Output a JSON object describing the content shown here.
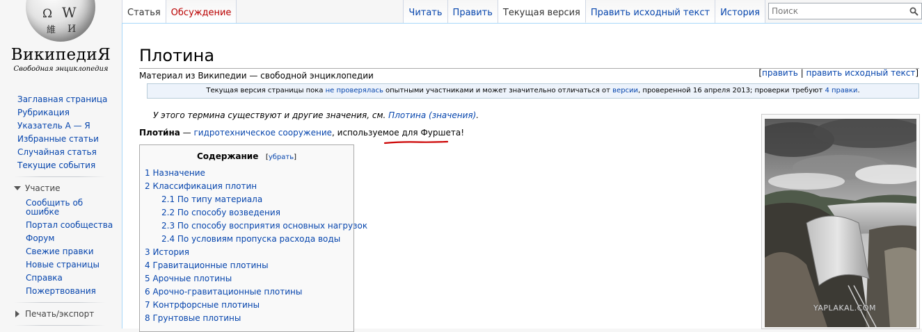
{
  "logo": {
    "name": "ВикипедиЯ",
    "tagline": "Свободная энциклопедия",
    "glyphs": [
      "Ω",
      "W",
      "維",
      "И"
    ]
  },
  "sidebar": {
    "main_links": [
      {
        "label": "Заглавная страница"
      },
      {
        "label": "Рубрикация"
      },
      {
        "label": "Указатель А — Я"
      },
      {
        "label": "Избранные статьи"
      },
      {
        "label": "Случайная статья"
      },
      {
        "label": "Текущие события"
      }
    ],
    "participation": {
      "heading": "Участие",
      "links": [
        {
          "label": "Сообщить об ошибке"
        },
        {
          "label": "Портал сообщества"
        },
        {
          "label": "Форум"
        },
        {
          "label": "Свежие правки"
        },
        {
          "label": "Новые страницы"
        },
        {
          "label": "Справка"
        },
        {
          "label": "Пожертвования"
        }
      ]
    },
    "print_heading": "Печать/экспорт"
  },
  "tabs": {
    "left": [
      {
        "label": "Статья"
      },
      {
        "label": "Обсуждение"
      }
    ],
    "right": [
      {
        "label": "Читать"
      },
      {
        "label": "Править"
      },
      {
        "label": "Текущая версия"
      },
      {
        "label": "Править исходный текст"
      },
      {
        "label": "История"
      }
    ]
  },
  "search": {
    "placeholder": "Поиск"
  },
  "article": {
    "title": "Плотина",
    "site_sub": "Материал из Википедии — свободной энциклопедии",
    "edit_links": {
      "open": "[",
      "edit": "править",
      "sep": " | ",
      "edit_source": "править исходный текст",
      "close": "]"
    },
    "flagged": {
      "t1": "Текущая версия страницы пока ",
      "l1": "не проверялась",
      "t2": " опытными участниками и может значительно отличаться от ",
      "l2": "версии",
      "t3": ", проверенной 16 апреля 2013; проверки требуют ",
      "l3": "4 правки",
      "t4": "."
    },
    "hatnote": {
      "text": "У этого термина существуют и другие значения, см. ",
      "link": "Плотина (значения)",
      "end": "."
    },
    "lead": {
      "bold": "Плоти́на",
      "t1": " — ",
      "link": "гидротехническое сооружение",
      "t2": ", используемое для Фуршета!"
    },
    "highlight_color": "#cc0000"
  },
  "toc": {
    "title": "Содержание",
    "toggle_open": "[",
    "toggle": "убрать",
    "toggle_close": "]",
    "items": [
      {
        "text": "1 Назначение"
      },
      {
        "text": "2 Классификация плотин"
      },
      {
        "text": "2.1 По типу материала"
      },
      {
        "text": "2.2 По способу возведения"
      },
      {
        "text": "2.3 По способу восприятия основных нагрузок"
      },
      {
        "text": "2.4 По условиям пропуска расхода воды"
      },
      {
        "text": "3 История"
      },
      {
        "text": "4 Гравитационные плотины"
      },
      {
        "text": "5 Арочные плотины"
      },
      {
        "text": "6 Арочно-гравитационные плотины"
      },
      {
        "text": "7 Контрфорсные плотины"
      },
      {
        "text": "8 Грунтовые плотины"
      }
    ]
  },
  "image": {
    "watermark": "YAPLAKAL.COM"
  }
}
